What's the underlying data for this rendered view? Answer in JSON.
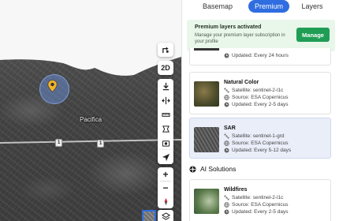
{
  "map": {
    "city_label": "Pacifica",
    "road_shields": [
      "1",
      "1"
    ],
    "controls": {
      "add_label": "+",
      "mode_label": "2D",
      "zoom_in": "+",
      "zoom_out": "−"
    }
  },
  "panel": {
    "tabs": [
      "Basemap",
      "Premium",
      "Layers"
    ],
    "active_tab": "Premium",
    "banner": {
      "title": "Premium layers activated",
      "text": "Manage your premium layer subscription in your profile",
      "button": "Manage"
    },
    "partial_card": {
      "meta": "Updated: Every 24 hours"
    },
    "cards": [
      {
        "title": "Natural Color",
        "satellite": "Satellite: sentinel-2-l1c",
        "source": "Source: ESA Copernicus",
        "updated": "Updated: Every 2-5 days"
      },
      {
        "title": "SAR",
        "satellite": "Satellite: sentinel-1-grd",
        "source": "Source: ESA Copernicus",
        "updated": "Updated: Every 5-12 days"
      },
      {
        "title": "Wildfires",
        "satellite": "Satellite: sentinel-2-l1c",
        "source": "Source: ESA Copernicus",
        "updated": "Updated: Every 2-5 days"
      }
    ],
    "section_title": "AI Solutions"
  },
  "colors": {
    "accent": "#2f6de0",
    "manage": "#1f9d55",
    "banner_bg": "#e9f6ea",
    "selected_bg": "#e9eef9"
  }
}
